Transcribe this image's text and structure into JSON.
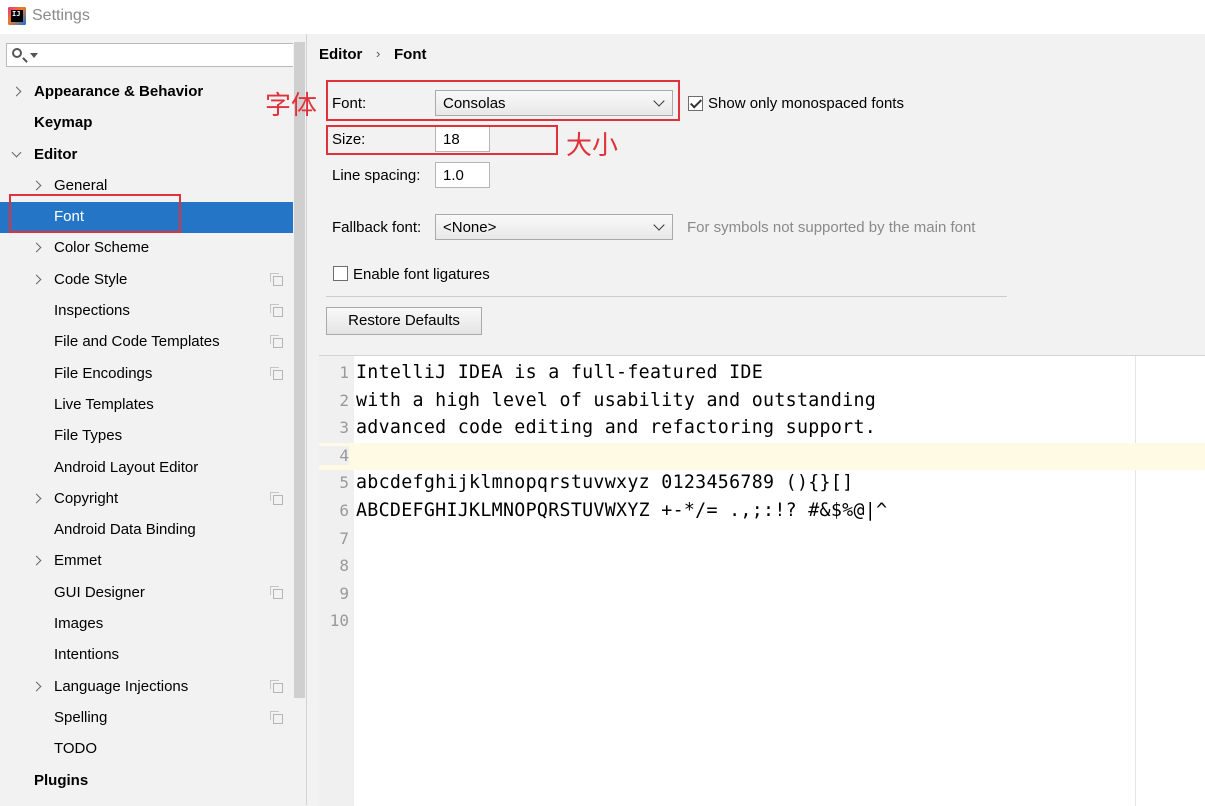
{
  "window": {
    "title": "Settings"
  },
  "search": {
    "placeholder": ""
  },
  "sidebar": {
    "items": [
      {
        "label": "Appearance & Behavior",
        "level": 0,
        "bold": true,
        "chevron": "right",
        "copy": false
      },
      {
        "label": "Keymap",
        "level": 0,
        "bold": true,
        "chevron": "",
        "copy": false
      },
      {
        "label": "Editor",
        "level": 0,
        "bold": true,
        "chevron": "down",
        "copy": false
      },
      {
        "label": "General",
        "level": 1,
        "bold": false,
        "chevron": "right",
        "copy": false
      },
      {
        "label": "Font",
        "level": 1,
        "bold": false,
        "chevron": "",
        "copy": false,
        "selected": true
      },
      {
        "label": "Color Scheme",
        "level": 1,
        "bold": false,
        "chevron": "right",
        "copy": false
      },
      {
        "label": "Code Style",
        "level": 1,
        "bold": false,
        "chevron": "right",
        "copy": true
      },
      {
        "label": "Inspections",
        "level": 1,
        "bold": false,
        "chevron": "",
        "copy": true
      },
      {
        "label": "File and Code Templates",
        "level": 1,
        "bold": false,
        "chevron": "",
        "copy": true
      },
      {
        "label": "File Encodings",
        "level": 1,
        "bold": false,
        "chevron": "",
        "copy": true
      },
      {
        "label": "Live Templates",
        "level": 1,
        "bold": false,
        "chevron": "",
        "copy": false
      },
      {
        "label": "File Types",
        "level": 1,
        "bold": false,
        "chevron": "",
        "copy": false
      },
      {
        "label": "Android Layout Editor",
        "level": 1,
        "bold": false,
        "chevron": "",
        "copy": false
      },
      {
        "label": "Copyright",
        "level": 1,
        "bold": false,
        "chevron": "right",
        "copy": true
      },
      {
        "label": "Android Data Binding",
        "level": 1,
        "bold": false,
        "chevron": "",
        "copy": false
      },
      {
        "label": "Emmet",
        "level": 1,
        "bold": false,
        "chevron": "right",
        "copy": false
      },
      {
        "label": "GUI Designer",
        "level": 1,
        "bold": false,
        "chevron": "",
        "copy": true
      },
      {
        "label": "Images",
        "level": 1,
        "bold": false,
        "chevron": "",
        "copy": false
      },
      {
        "label": "Intentions",
        "level": 1,
        "bold": false,
        "chevron": "",
        "copy": false
      },
      {
        "label": "Language Injections",
        "level": 1,
        "bold": false,
        "chevron": "right",
        "copy": true
      },
      {
        "label": "Spelling",
        "level": 1,
        "bold": false,
        "chevron": "",
        "copy": true
      },
      {
        "label": "TODO",
        "level": 1,
        "bold": false,
        "chevron": "",
        "copy": false
      },
      {
        "label": "Plugins",
        "level": 0,
        "bold": true,
        "chevron": "",
        "copy": false
      }
    ]
  },
  "breadcrumb": {
    "parent": "Editor",
    "separator": "›",
    "current": "Font"
  },
  "form": {
    "font_label": "Font:",
    "font_value": "Consolas",
    "monospaced_label": "Show only monospaced fonts",
    "monospaced_checked": true,
    "size_label": "Size:",
    "size_value": "18",
    "line_spacing_label": "Line spacing:",
    "line_spacing_value": "1.0",
    "fallback_label": "Fallback font:",
    "fallback_value": "<None>",
    "fallback_hint": "For symbols not supported by the main font",
    "ligatures_label": "Enable font ligatures",
    "ligatures_checked": false,
    "restore_label": "Restore Defaults"
  },
  "annotations": {
    "font_note": "字体",
    "size_note": "大小",
    "color": "#e0323a"
  },
  "preview": {
    "lines": [
      {
        "n": "1",
        "text": "IntelliJ IDEA is a full-featured IDE"
      },
      {
        "n": "2",
        "text": "with a high level of usability and outstanding"
      },
      {
        "n": "3",
        "text": "advanced code editing and refactoring support."
      },
      {
        "n": "4",
        "text": ""
      },
      {
        "n": "5",
        "text": "abcdefghijklmnopqrstuvwxyz 0123456789 (){}[]"
      },
      {
        "n": "6",
        "text": "ABCDEFGHIJKLMNOPQRSTUVWXYZ +-*/= .,;:!? #&$%@|^"
      },
      {
        "n": "7",
        "text": ""
      },
      {
        "n": "8",
        "text": ""
      },
      {
        "n": "9",
        "text": ""
      },
      {
        "n": "10",
        "text": ""
      }
    ],
    "current_line": "4"
  },
  "colors": {
    "selection": "#2575c6",
    "annotation_red": "#e0323a"
  }
}
